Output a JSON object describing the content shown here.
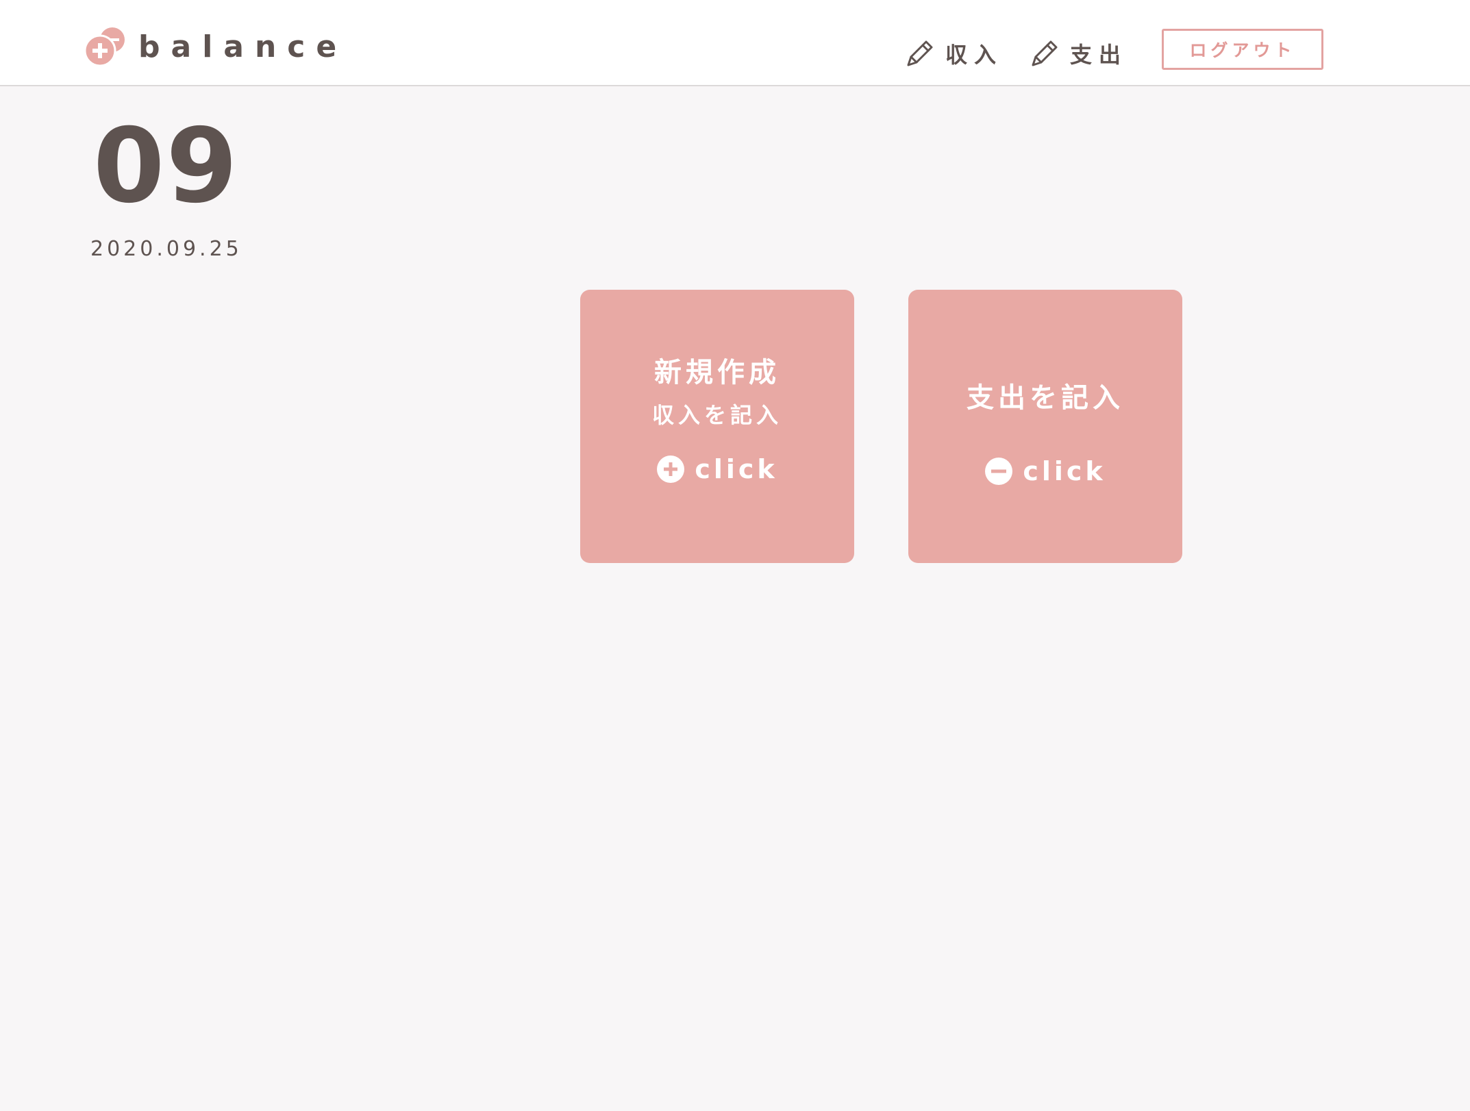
{
  "header": {
    "brand": "balance",
    "nav": {
      "income_label": "収入",
      "expense_label": "支出"
    },
    "logout_label": "ログアウト"
  },
  "date_display": {
    "month": "09",
    "full_date": "2020.09.25"
  },
  "cards": {
    "income": {
      "title": "新規作成",
      "subtitle": "収入を記入",
      "action_label": "click",
      "action_icon": "plus-circle-icon"
    },
    "expense": {
      "title": "支出を記入",
      "action_label": "click",
      "action_icon": "minus-circle-icon"
    }
  },
  "colors": {
    "accent": "#e8a9a4",
    "logout_border": "#e3a3a1",
    "text": "#5e5350",
    "background": "#f8f6f7",
    "header_background": "#ffffff"
  }
}
